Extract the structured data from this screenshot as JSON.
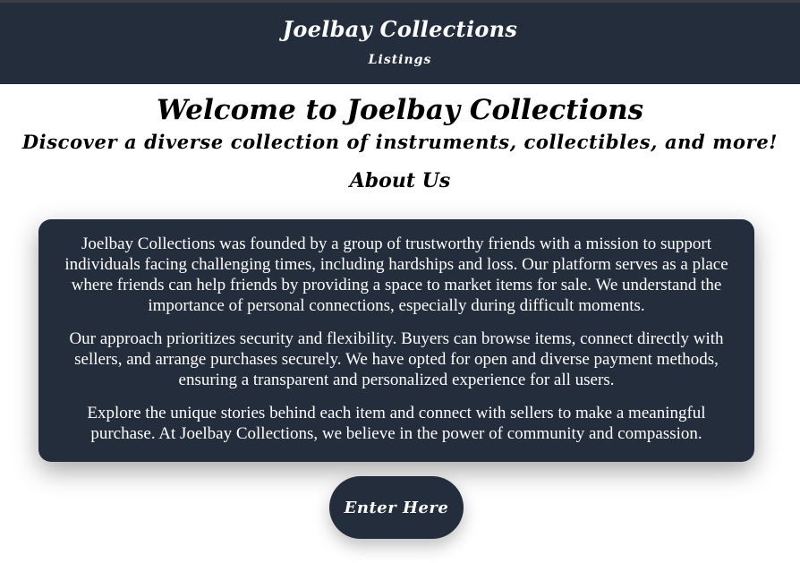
{
  "header": {
    "brand": "Joelbay Collections",
    "nav_link": "Listings"
  },
  "hero": {
    "title": "Welcome to Joelbay Collections",
    "tagline": "Discover a diverse collection of instruments, collectibles, and more!"
  },
  "about": {
    "heading": "About Us",
    "paragraphs": [
      "Joelbay Collections was founded by a group of trustworthy friends with a mission to support individuals facing challenging times, including hardships and loss. Our platform serves as a place where friends can help friends by providing a space to market items for sale. We understand the importance of personal connections, especially during difficult moments.",
      "Our approach prioritizes security and flexibility. Buyers can browse items, connect directly with sellers, and arrange purchases securely. We have opted for open and diverse payment methods, ensuring a transparent and personalized experience for all users.",
      "Explore the unique stories behind each item and connect with sellers to make a meaningful purchase. At Joelbay Collections, we believe in the power of community and compassion."
    ]
  },
  "cta": {
    "label": "Enter Here"
  },
  "colors": {
    "navy": "#232d3c",
    "background": "#ffffff",
    "text_light": "#ffffff"
  }
}
